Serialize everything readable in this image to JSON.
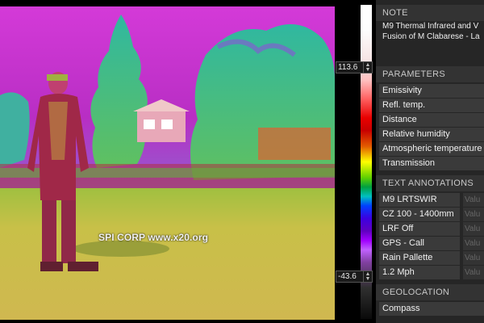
{
  "image": {
    "watermark": "SPI CORP www.x20.org"
  },
  "scale": {
    "max_value": "113.6",
    "min_value": "-43.6",
    "up_arrow": "▲",
    "down_arrow": "▼"
  },
  "note": {
    "header": "NOTE",
    "line1": "M9 Thermal Infrared and V",
    "line2": "Fusion of M Clabarese - La"
  },
  "parameters": {
    "header": "PARAMETERS",
    "items": [
      {
        "label": "Emissivity"
      },
      {
        "label": "Refl. temp."
      },
      {
        "label": "Distance"
      },
      {
        "label": "Relative humidity"
      },
      {
        "label": "Atmospheric temperature"
      },
      {
        "label": "Transmission"
      }
    ]
  },
  "text_annotations": {
    "header": "TEXT ANNOTATIONS",
    "items": [
      {
        "label": "M9 LRTSWIR",
        "value": "Valu"
      },
      {
        "label": "CZ 100 - 1400mm",
        "value": "Valu"
      },
      {
        "label": "LRF Off",
        "value": "Valu"
      },
      {
        "label": "GPS - Call",
        "value": "Valu"
      },
      {
        "label": "Rain Pallette",
        "value": "Valu"
      },
      {
        "label": "1.2 Mph",
        "value": "Valu"
      }
    ]
  },
  "geolocation": {
    "header": "GEOLOCATION",
    "items": [
      {
        "label": "Compass"
      }
    ]
  },
  "colors": {
    "sky": "#c030c8",
    "ground": "#c8c048",
    "panel_bg": "#262626",
    "row_bg": "#3a3a3a"
  }
}
